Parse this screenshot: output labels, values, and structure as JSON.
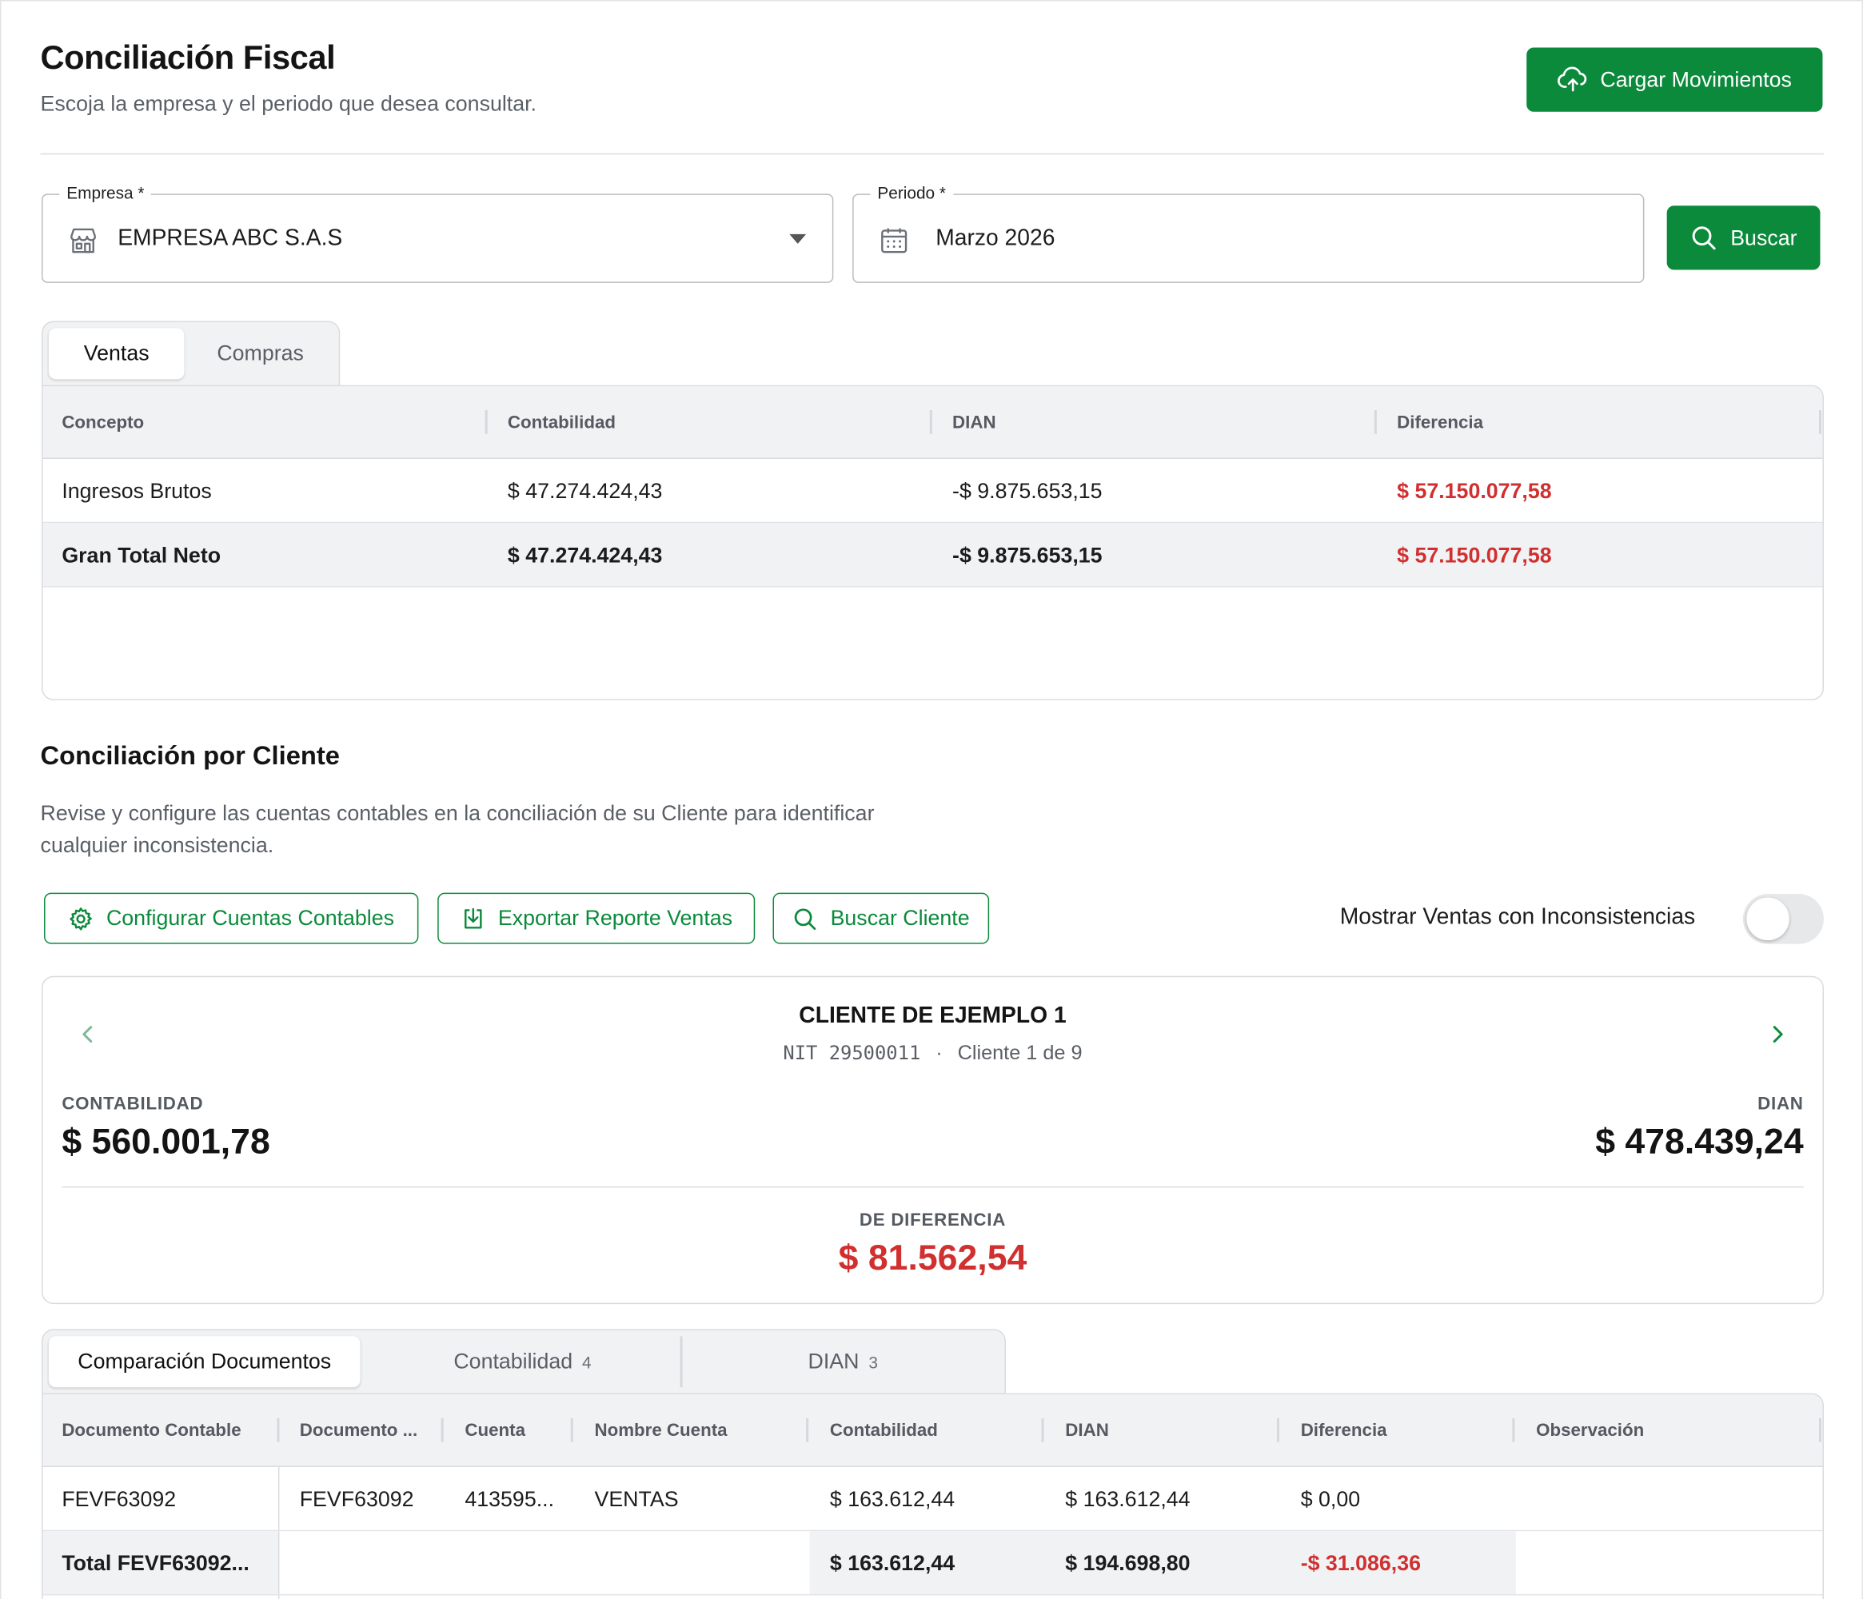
{
  "header": {
    "title": "Conciliación Fiscal",
    "subtitle": "Escoja la empresa y el periodo que desea consultar.",
    "upload_button": "Cargar Movimientos"
  },
  "filters": {
    "empresa_label": "Empresa",
    "empresa_value": "EMPRESA ABC S.A.S",
    "periodo_label": "Periodo",
    "periodo_value": "Marzo 2026",
    "required_mark": "*",
    "search_button": "Buscar"
  },
  "main_tabs": [
    {
      "label": "Ventas",
      "active": true
    },
    {
      "label": "Compras",
      "active": false
    }
  ],
  "summary_table": {
    "headers": [
      "Concepto",
      "Contabilidad",
      "DIAN",
      "Diferencia"
    ],
    "rows": [
      {
        "concepto": "Ingresos Brutos",
        "contabilidad": "$ 47.274.424,43",
        "dian": "-$ 9.875.653,15",
        "diferencia": "$ 57.150.077,58"
      },
      {
        "concepto": "Gran Total Neto",
        "contabilidad": "$ 47.274.424,43",
        "dian": "-$ 9.875.653,15",
        "diferencia": "$ 57.150.077,58"
      }
    ]
  },
  "client_section": {
    "title": "Conciliación por Cliente",
    "description": "Revise y configure las cuentas contables en la conciliación de su Cliente para identificar cualquier inconsistencia.",
    "actions": {
      "configure": "Configurar Cuentas Contables",
      "export": "Exportar Reporte Ventas",
      "search": "Buscar Cliente"
    },
    "toggle_label": "Mostrar Ventas con Inconsistencias",
    "toggle_on": false
  },
  "client_card": {
    "name": "CLIENTE DE EJEMPLO 1",
    "nit": "NIT 29500011",
    "separator": "·",
    "position": "Cliente 1 de 9",
    "contabilidad_label": "CONTABILIDAD",
    "contabilidad_value": "$ 560.001,78",
    "dian_label": "DIAN",
    "dian_value": "$ 478.439,24",
    "diferencia_label": "DE DIFERENCIA",
    "diferencia_value": "$ 81.562,54"
  },
  "doc_tabs": [
    {
      "label": "Comparación Documentos",
      "count": "",
      "active": true
    },
    {
      "label": "Contabilidad",
      "count": "4",
      "active": false
    },
    {
      "label": "DIAN",
      "count": "3",
      "active": false
    }
  ],
  "doc_table": {
    "headers": [
      "Documento Contable",
      "Documento ...",
      "Cuenta",
      "Nombre Cuenta",
      "Contabilidad",
      "DIAN",
      "Diferencia",
      "Observación"
    ],
    "row": {
      "doc_contable": "FEVF63092",
      "doc_dian": "FEVF63092",
      "cuenta": "413595...",
      "nombre_cuenta": "VENTAS",
      "contabilidad": "$ 163.612,44",
      "dian": "$ 163.612,44",
      "diferencia": "$ 0,00",
      "observacion": ""
    },
    "total": {
      "label": "Total FEVF63092...",
      "contabilidad": "$ 163.612,44",
      "dian": "$ 194.698,80",
      "diferencia": "-$ 31.086,36"
    }
  },
  "colors": {
    "primary": "#0b8a3b",
    "negative": "#d0302f",
    "header_bg": "#f1f2f4"
  }
}
